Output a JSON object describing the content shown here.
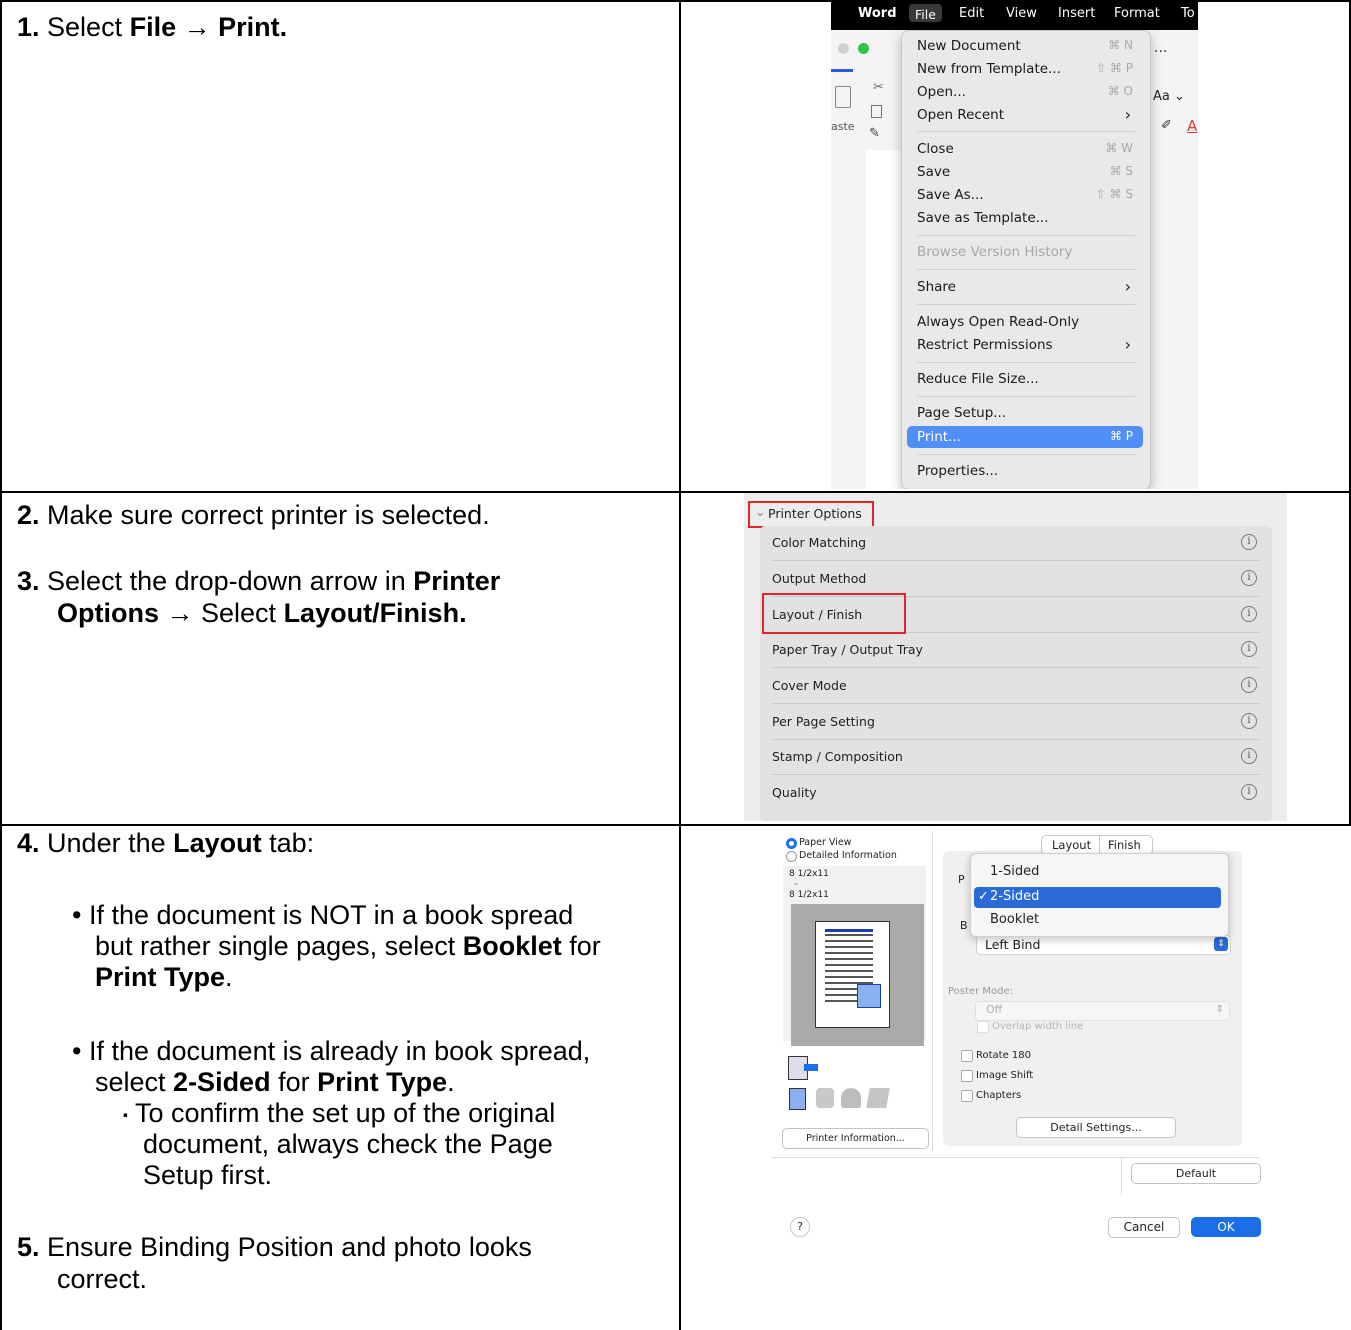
{
  "steps": {
    "s1_num": "1.",
    "s1_a": " Select ",
    "s1_b": "File",
    "s1_arrow": " → ",
    "s1_c": "Print.",
    "s2_num": "2.",
    "s2_text": " Make sure correct printer is selected.",
    "s3_num": "3.",
    "s3_a": " Select the drop-down arrow in ",
    "s3_b": "Printer",
    "s3_c": "Options",
    "s3_arrow": " → ",
    "s3_d": " Select ",
    "s3_e": "Layout/Finish.",
    "s4_num": "4.",
    "s4_a": " Under the ",
    "s4_b": "Layout",
    "s4_c": " tab:",
    "b1_dot": "•",
    "b1_l1": "If the document is NOT in a book spread",
    "b1_l2a": "but rather single pages, select ",
    "b1_l2b": "Booklet",
    "b1_l2c": " for",
    "b1_l3a": "Print Type",
    "b1_l3b": ".",
    "b2_dot": "•",
    "b2_l1": "If the document is already in book spread,",
    "b2_l2a": "select ",
    "b2_l2b": "2-Sided",
    "b2_l2c": " for ",
    "b2_l2d": "Print Type",
    "b2_l2e": ".",
    "sub_sq": "▪",
    "sub_l1": " To confirm the set up of the original",
    "sub_l2": "document, always check the Page",
    "sub_l3": "Setup first.",
    "s5_num": "5.",
    "s5_l1": " Ensure Binding Position and photo looks",
    "s5_l2": "correct."
  },
  "menubar": {
    "apple": "",
    "app": "Word",
    "file": "File",
    "edit": "Edit",
    "view": "View",
    "insert": "Insert",
    "format": "Format",
    "tools": "To"
  },
  "file_menu": {
    "new_document": "New Document",
    "new_document_sc": "⌘ N",
    "new_from_template": "New from Template...",
    "new_from_template_sc": "⇧ ⌘ P",
    "open": "Open...",
    "open_sc": "⌘ O",
    "open_recent": "Open Recent",
    "arrow": "›",
    "close": "Close",
    "close_sc": "⌘ W",
    "save": "Save",
    "save_sc": "⌘ S",
    "save_as": "Save As...",
    "save_as_sc": "⇧ ⌘ S",
    "save_as_template": "Save as Template...",
    "browse_version_history": "Browse Version History",
    "share": "Share",
    "always_open_read_only": "Always Open Read-Only",
    "restrict_permissions": "Restrict Permissions",
    "reduce_file_size": "Reduce File Size...",
    "page_setup": "Page Setup...",
    "print": "Print...",
    "print_sc": "⌘ P",
    "properties": "Properties..."
  },
  "word_bg": {
    "ellipsis": "...",
    "aa": "Aa ⌄",
    "paste": "aste"
  },
  "printer_options": {
    "header": "Printer Options",
    "header_chev": "⌄",
    "info": "i",
    "rows": [
      "Color Matching",
      "Output Method",
      "Layout / Finish",
      "Paper Tray / Output Tray",
      "Cover Mode",
      "Per Page Setting",
      "Stamp / Composition",
      "Quality"
    ]
  },
  "layout_dialog": {
    "paper_view": "Paper View",
    "detailed_information": "Detailed Information",
    "size_top": "8 1/2x11",
    "size_chev": "⌄",
    "size_bottom": "8 1/2x11",
    "tab_layout": "Layout",
    "tab_finish": "Finish",
    "print_type_options": [
      "1-Sided",
      "2-Sided",
      "Booklet"
    ],
    "check": "✓",
    "hidden_p": "P",
    "hidden_b": "B",
    "binding_value": "Left Bind",
    "poster_mode_label": "Poster Mode:",
    "poster_mode_value": "Off",
    "overlap": "Overlap width line",
    "rotate": "Rotate 180",
    "image_shift": "Image Shift",
    "chapters": "Chapters",
    "detail_settings": "Detail Settings...",
    "printer_information": "Printer Information...",
    "default": "Default",
    "help": "?",
    "cancel": "Cancel",
    "ok": "OK",
    "updown": "⇕"
  }
}
